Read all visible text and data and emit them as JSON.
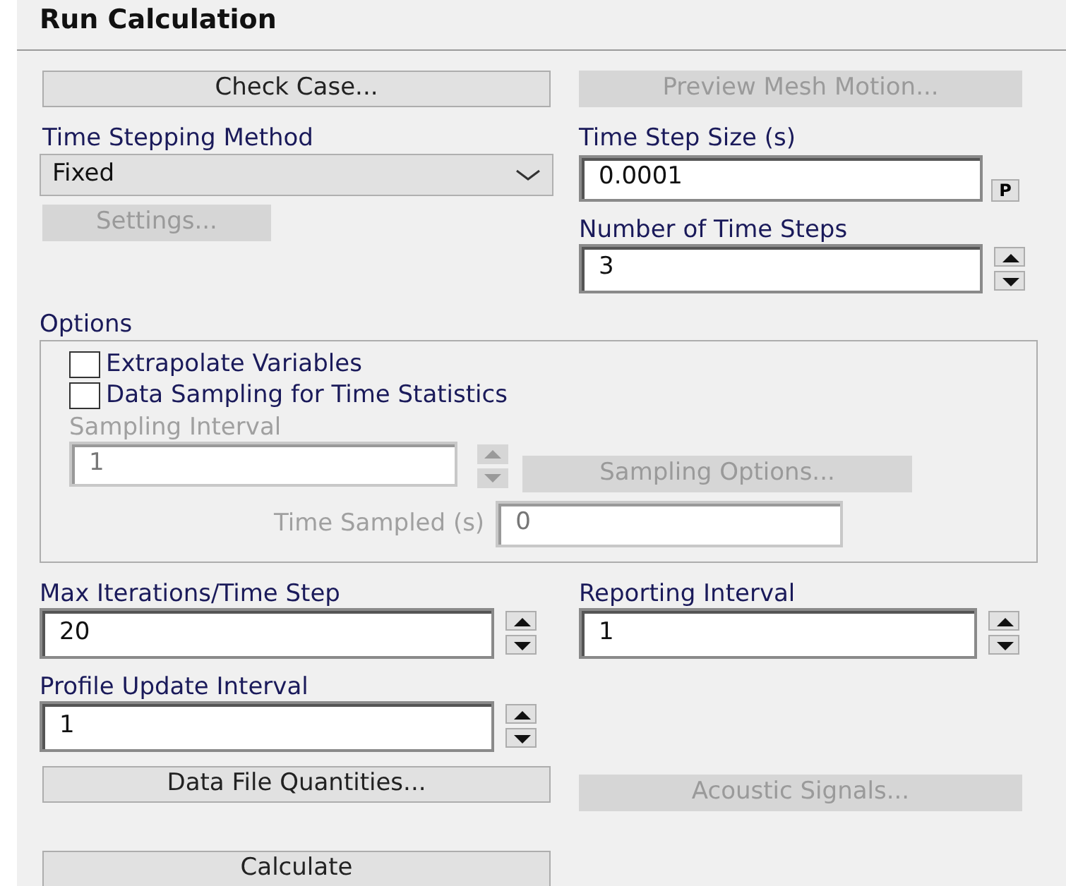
{
  "title": "Run Calculation",
  "check_case": {
    "label": "Check Case...",
    "disabled": false
  },
  "preview_mesh": {
    "label": "Preview Mesh Motion...",
    "disabled": true
  },
  "time_stepping": {
    "label": "Time Stepping Method",
    "value": "Fixed"
  },
  "settings": {
    "label": "Settings...",
    "disabled": true
  },
  "time_step_size": {
    "label": "Time Step Size (s)",
    "value": "0.0001",
    "parameter_button": "P"
  },
  "number_of_time_steps": {
    "label": "Number of Time Steps",
    "value": "3",
    "disabled": false
  },
  "options": {
    "label": "Options",
    "checkboxes": [
      {
        "label": "Extrapolate Variables",
        "checked": false
      },
      {
        "label": "Data Sampling for Time Statistics",
        "checked": false
      }
    ],
    "sampling_interval": {
      "label": "Sampling Interval",
      "value": "1",
      "disabled": true
    },
    "sampling_options": {
      "label": "Sampling Options...",
      "disabled": true
    },
    "time_sampled": {
      "label": "Time Sampled (s)",
      "value": "0",
      "disabled": true
    }
  },
  "max_iterations": {
    "label": "Max Iterations/Time Step",
    "value": "20",
    "disabled": false
  },
  "reporting_interval": {
    "label": "Reporting Interval",
    "value": "1",
    "disabled": false
  },
  "profile_update": {
    "label": "Profile Update Interval",
    "value": "1",
    "disabled": false
  },
  "data_file_quantities": {
    "label": "Data File Quantities...",
    "disabled": false
  },
  "acoustic_signals": {
    "label": "Acoustic Signals...",
    "disabled": true
  },
  "calculate": {
    "label": "Calculate",
    "disabled": false
  }
}
